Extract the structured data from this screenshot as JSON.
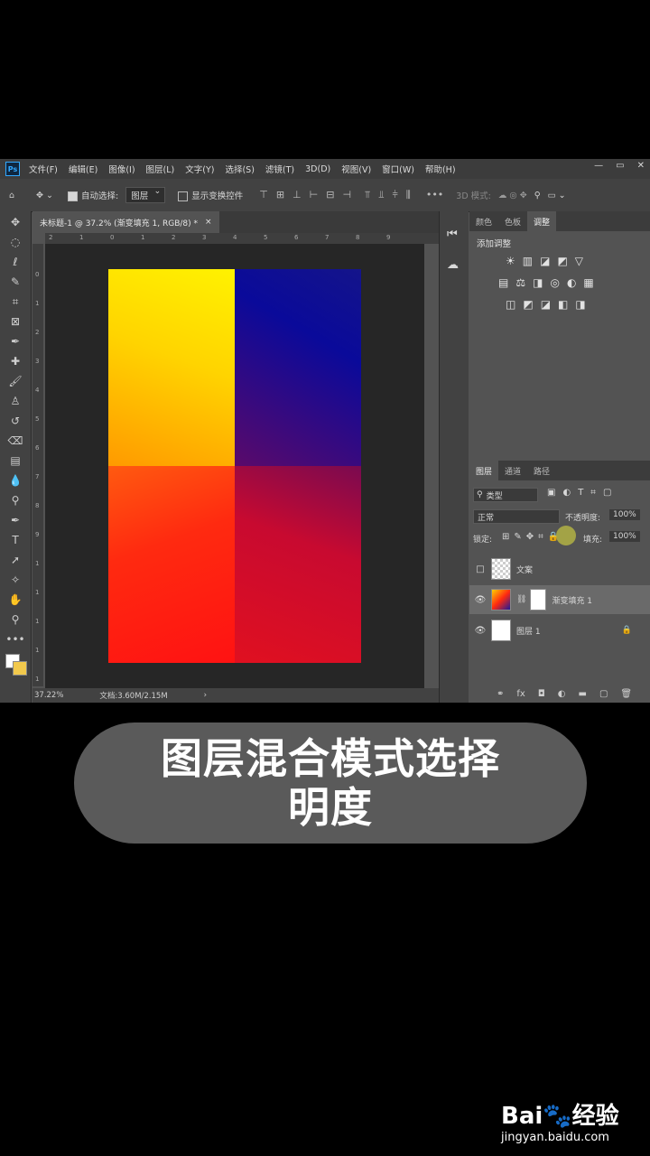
{
  "menubar": {
    "logo": "Ps",
    "items": [
      "文件(F)",
      "编辑(E)",
      "图像(I)",
      "图层(L)",
      "文字(Y)",
      "选择(S)",
      "滤镜(T)",
      "3D(D)",
      "视图(V)",
      "窗口(W)",
      "帮助(H)"
    ],
    "win_controls": [
      "—",
      "▭",
      "✕"
    ]
  },
  "options": {
    "auto_select_label": "自动选择:",
    "auto_select_value": "图层",
    "show_transform_label": "显示变换控件",
    "mode_3d": "3D 模式:"
  },
  "document": {
    "tab_title": "未标题-1 @ 37.2% (渐变填充 1, RGB/8) *",
    "close": "×",
    "zoom": "37.22%",
    "doc_info": "文档:3.60M/2.15M",
    "ruler_h": [
      "2",
      "1",
      "0",
      "1",
      "2",
      "3",
      "4",
      "5",
      "6",
      "7",
      "8",
      "9"
    ],
    "ruler_v": [
      "0",
      "1",
      "2",
      "3",
      "4",
      "5",
      "6",
      "7",
      "8",
      "9",
      "1",
      "1",
      "1",
      "1",
      "1"
    ]
  },
  "right_panel": {
    "top_tabs": [
      "颜色",
      "色板",
      "调整"
    ],
    "adjust_title": "添加调整",
    "adjust_rows": [
      [
        "☀",
        "▥",
        "◪",
        "◩",
        "▽"
      ],
      [
        "▤",
        "⚖",
        "◨",
        "◎",
        "◐",
        "▦"
      ],
      [
        "◫",
        "◩",
        "◪",
        "◧",
        "◨"
      ]
    ],
    "layer_tabs": [
      "图层",
      "通道",
      "路径"
    ],
    "filter_label": "类型",
    "blend_mode": "正常",
    "opacity_label": "不透明度:",
    "opacity_value": "100%",
    "lock_label": "锁定:",
    "fill_label": "填充:",
    "fill_value": "100%",
    "layers": [
      {
        "name": "文案"
      },
      {
        "name": "渐变填充 1"
      },
      {
        "name": "图层 1"
      }
    ],
    "bottom_icons": [
      "⚭",
      "fx",
      "◘",
      "◐",
      "▬",
      "▢",
      "🗑"
    ]
  },
  "caption": {
    "line1": "图层混合模式选择",
    "line2": "明度"
  },
  "watermark": {
    "logo": "Bai🐾经验",
    "url": "jingyan.baidu.com"
  }
}
